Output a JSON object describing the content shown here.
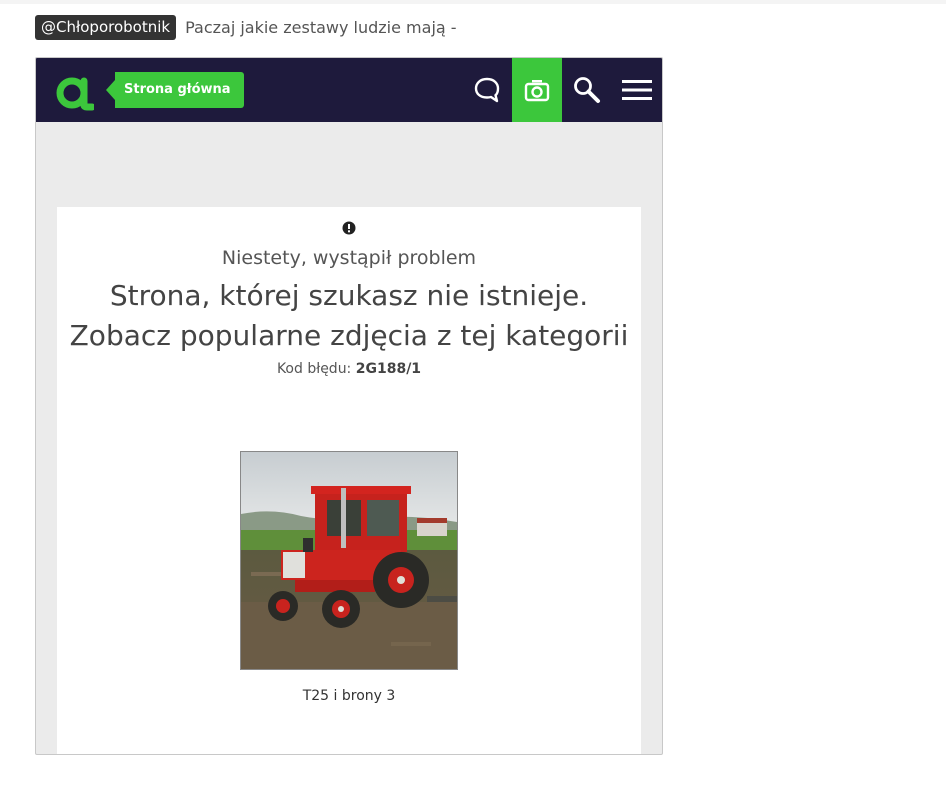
{
  "post": {
    "mention": "@Chłoporobotnik",
    "text": "Paczaj jakie zestawy ludzie mają -"
  },
  "embed": {
    "nav": {
      "home_label": "Strona główna",
      "icons": [
        "chat-icon",
        "camera-icon",
        "search-icon",
        "hamburger-menu-icon"
      ],
      "accent_color": "#3cc73c",
      "background_color": "#1e1a3c"
    },
    "error": {
      "subtitle": "Niestety, wystąpił problem",
      "headline_line1": "Strona, której szukasz nie istnieje.",
      "headline_line2": "Zobacz popularne zdjęcia z tej kategorii",
      "code_label": "Kod błędu:",
      "code_value": "2G188/1"
    },
    "featured": {
      "caption": "T25 i brony 3"
    }
  }
}
